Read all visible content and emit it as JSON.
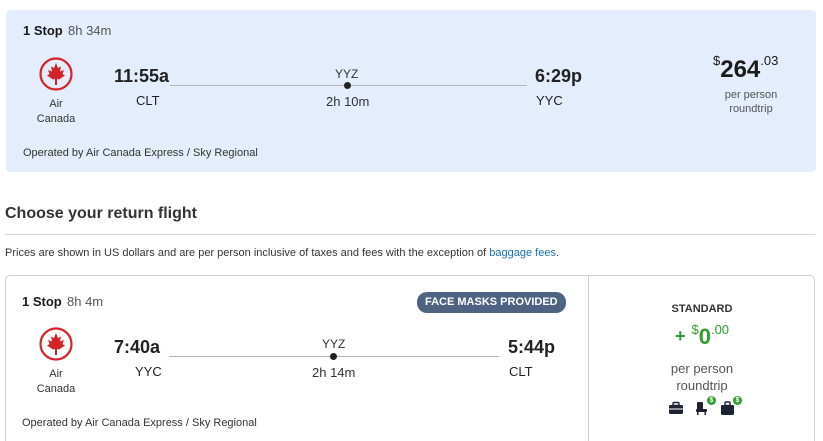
{
  "outbound": {
    "stops": "1 Stop",
    "total_duration": "8h 34m",
    "airline_line1": "Air",
    "airline_line2": "Canada",
    "depart_time": "11:55a",
    "depart_code": "CLT",
    "via_code": "YYZ",
    "layover": "2h 10m",
    "arrive_time": "6:29p",
    "arrive_code": "YYC",
    "operated_by": "Operated by Air Canada Express / Sky Regional",
    "price_symbol": "$",
    "price_whole": "264",
    "price_cents": ".03",
    "price_sub1": "per person",
    "price_sub2": "roundtrip"
  },
  "section": {
    "title": "Choose your return flight",
    "notice": "Prices are shown in US dollars and are per person inclusive of taxes and fees with the exception of",
    "baggage_link": "baggage fees",
    "notice_end": "."
  },
  "return_flight": {
    "stops": "1 Stop",
    "total_duration": "8h 4m",
    "badge": "FACE MASKS PROVIDED",
    "airline_line1": "Air",
    "airline_line2": "Canada",
    "depart_time": "7:40a",
    "depart_code": "YYC",
    "via_code": "YYZ",
    "layover": "2h 14m",
    "arrive_time": "5:44p",
    "arrive_code": "CLT",
    "operated_by": "Operated by Air Canada Express / Sky Regional",
    "fare": {
      "name": "STANDARD",
      "plus": "+",
      "symbol": "$",
      "whole": "0",
      "cents": ".00",
      "sub1": "per person",
      "sub2": "roundtrip",
      "fee_symbol": "$",
      "amenities": [
        "personal-item-icon",
        "seat-selection-icon",
        "checked-bag-icon"
      ]
    }
  },
  "colors": {
    "selected_bg": "#e3edfb",
    "airline_red": "#d2232a",
    "badge_bg": "#4e6382",
    "price_green": "#2e9c2e",
    "link_blue": "#1a6fb5"
  }
}
